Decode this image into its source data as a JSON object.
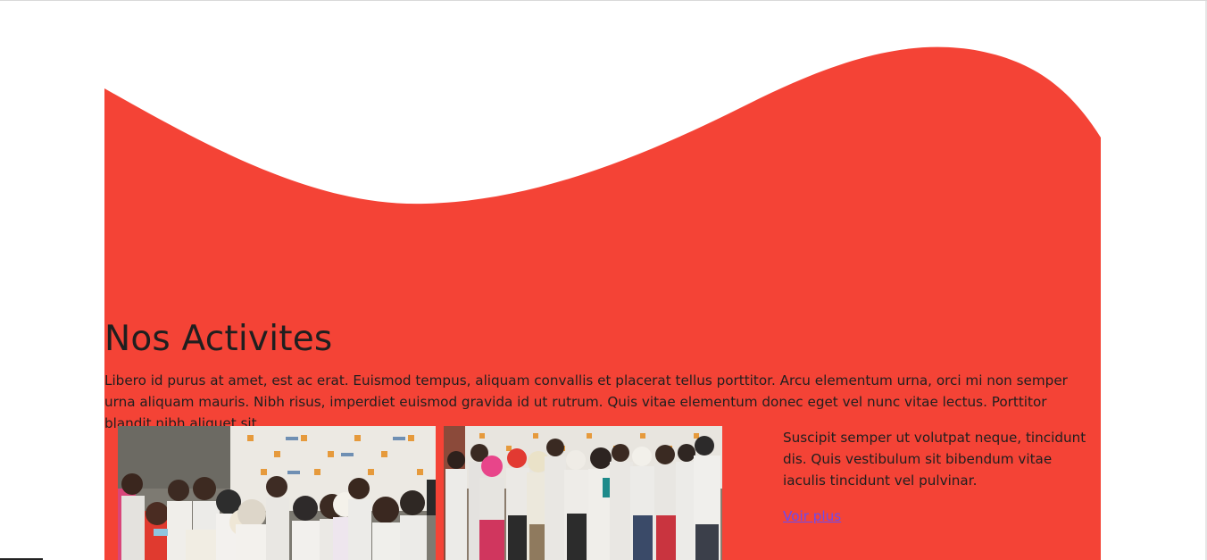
{
  "colors": {
    "accent": "#f44336",
    "text": "#1f1f1f",
    "link": "#6b4bf0"
  },
  "activities": {
    "title": "Nos Activites",
    "intro": "Libero id purus at amet, est ac erat. Euismod tempus, aliquam convallis et placerat tellus porttitor. Arcu elementum urna, orci mi non semper urna aliquam mauris. Nibh risus, imperdiet euismod gravida id ut rutrum. Quis vitae elementum donec eget vel nunc vitae lectus. Porttitor blandit nibh aliquet sit",
    "side_text": "Suscipit semper ut volutpat neque, tincidunt dis. Quis vestibulum sit bibendum vitae iaculis tincidunt vel pulvinar.",
    "link_label": "Voir plus"
  },
  "images": [
    {
      "name": "group-photo-1",
      "subject": "group of young people in white t-shirts in front of a sponsor banner"
    },
    {
      "name": "group-photo-2",
      "subject": "group of young people in white t-shirts standing in front of a banner"
    }
  ]
}
